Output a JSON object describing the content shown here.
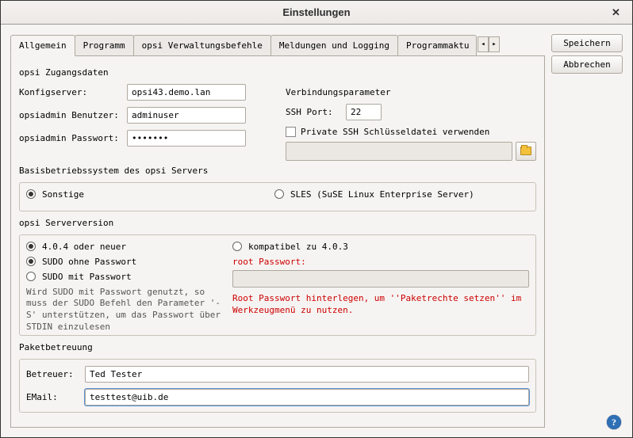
{
  "window": {
    "title": "Einstellungen"
  },
  "buttons": {
    "save": "Speichern",
    "cancel": "Abbrechen"
  },
  "tabs": {
    "general": "Allgemein",
    "program": "Programm",
    "opsi_cmds": "opsi Verwaltungsbefehle",
    "logging": "Meldungen und Logging",
    "updates": "Programmaktu"
  },
  "access": {
    "title": "opsi Zugangsdaten",
    "configserver_label": "Konfigserver:",
    "configserver_value": "opsi43.demo.lan",
    "user_label": "opsiadmin Benutzer:",
    "user_value": "adminuser",
    "pass_label": "opsiadmin Passwort:",
    "pass_value": "•••••••"
  },
  "conn": {
    "title": "Verbindungsparameter",
    "ssh_port_label": "SSH Port:",
    "ssh_port_value": "22",
    "keyfile_label": "Private SSH Schlüsseldatei verwenden"
  },
  "os": {
    "title": "Basisbetriebssystem des opsi Servers",
    "other": "Sonstige",
    "sles": "SLES (SuSE Linux Enterprise Server)"
  },
  "ver": {
    "title": "opsi Serverversion",
    "v404": "4.0.4 oder neuer",
    "sudo_nopw": "SUDO ohne Passwort",
    "sudo_pw": "SUDO mit Passwort",
    "compat": "kompatibel zu 4.0.3",
    "root_pw_label": "root Passwort:",
    "note_gray": "Wird SUDO mit Passwort genutzt, so muss der SUDO Befehl den Parameter '-S' unterstützen, um das Passwort über STDIN einzulesen",
    "note_red": "Root Passwort hinterlegen, um ''Paketrechte setzen'' im Werkzeugmenü zu nutzen."
  },
  "maint": {
    "title": "Paketbetreuung",
    "maintainer_label": "Betreuer:",
    "maintainer_value": "Ted Tester",
    "email_label": "EMail:",
    "email_value": "testtest@uib.de"
  }
}
